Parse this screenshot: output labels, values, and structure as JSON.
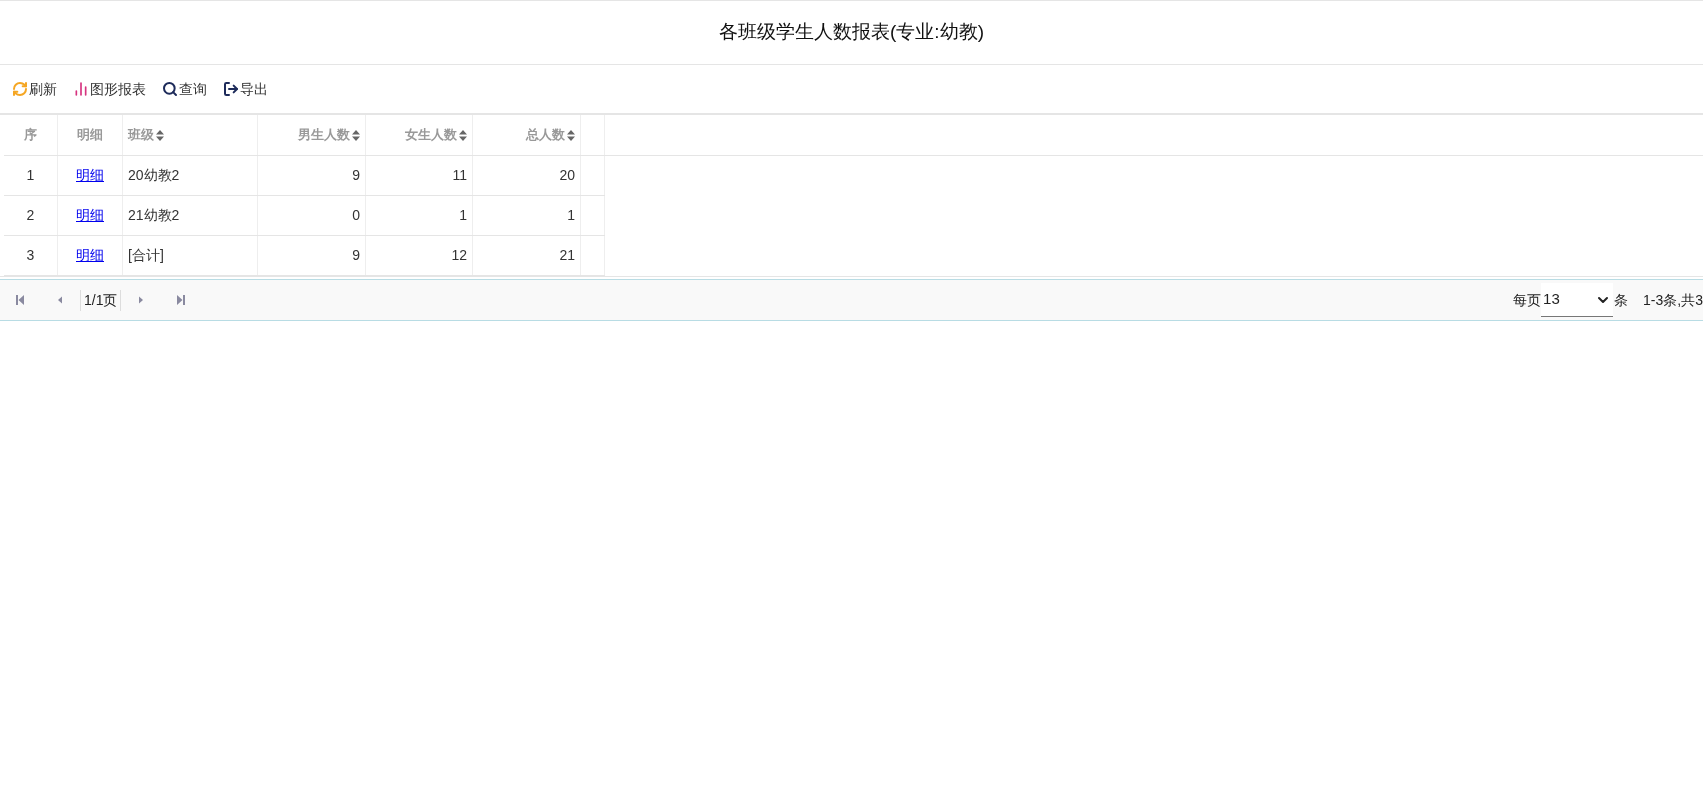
{
  "title": "各班级学生人数报表(专业:幼教)",
  "toolbar": [
    {
      "kind": "refresh",
      "label": "刷新"
    },
    {
      "kind": "chart",
      "label": "图形报表"
    },
    {
      "kind": "search",
      "label": "查询"
    },
    {
      "kind": "export",
      "label": "导出"
    }
  ],
  "table": {
    "columns": [
      {
        "label": "序",
        "sortable": false
      },
      {
        "label": "明细",
        "sortable": false
      },
      {
        "label": "班级",
        "sortable": true
      },
      {
        "label": "男生人数",
        "sortable": true
      },
      {
        "label": "女生人数",
        "sortable": true
      },
      {
        "label": "总人数",
        "sortable": true
      }
    ],
    "rows": [
      [
        "1",
        "明细",
        "20幼教2",
        "9",
        "11",
        "20"
      ],
      [
        "2",
        "明细",
        "21幼教2",
        "0",
        "1",
        "1"
      ],
      [
        "3",
        "明细",
        "[合计]",
        "9",
        "12",
        "21"
      ]
    ]
  },
  "pager": {
    "page": "1/1页",
    "per_page_label": "每页",
    "per_page": "13",
    "unit": "条",
    "summary": "1-3条,共3"
  }
}
